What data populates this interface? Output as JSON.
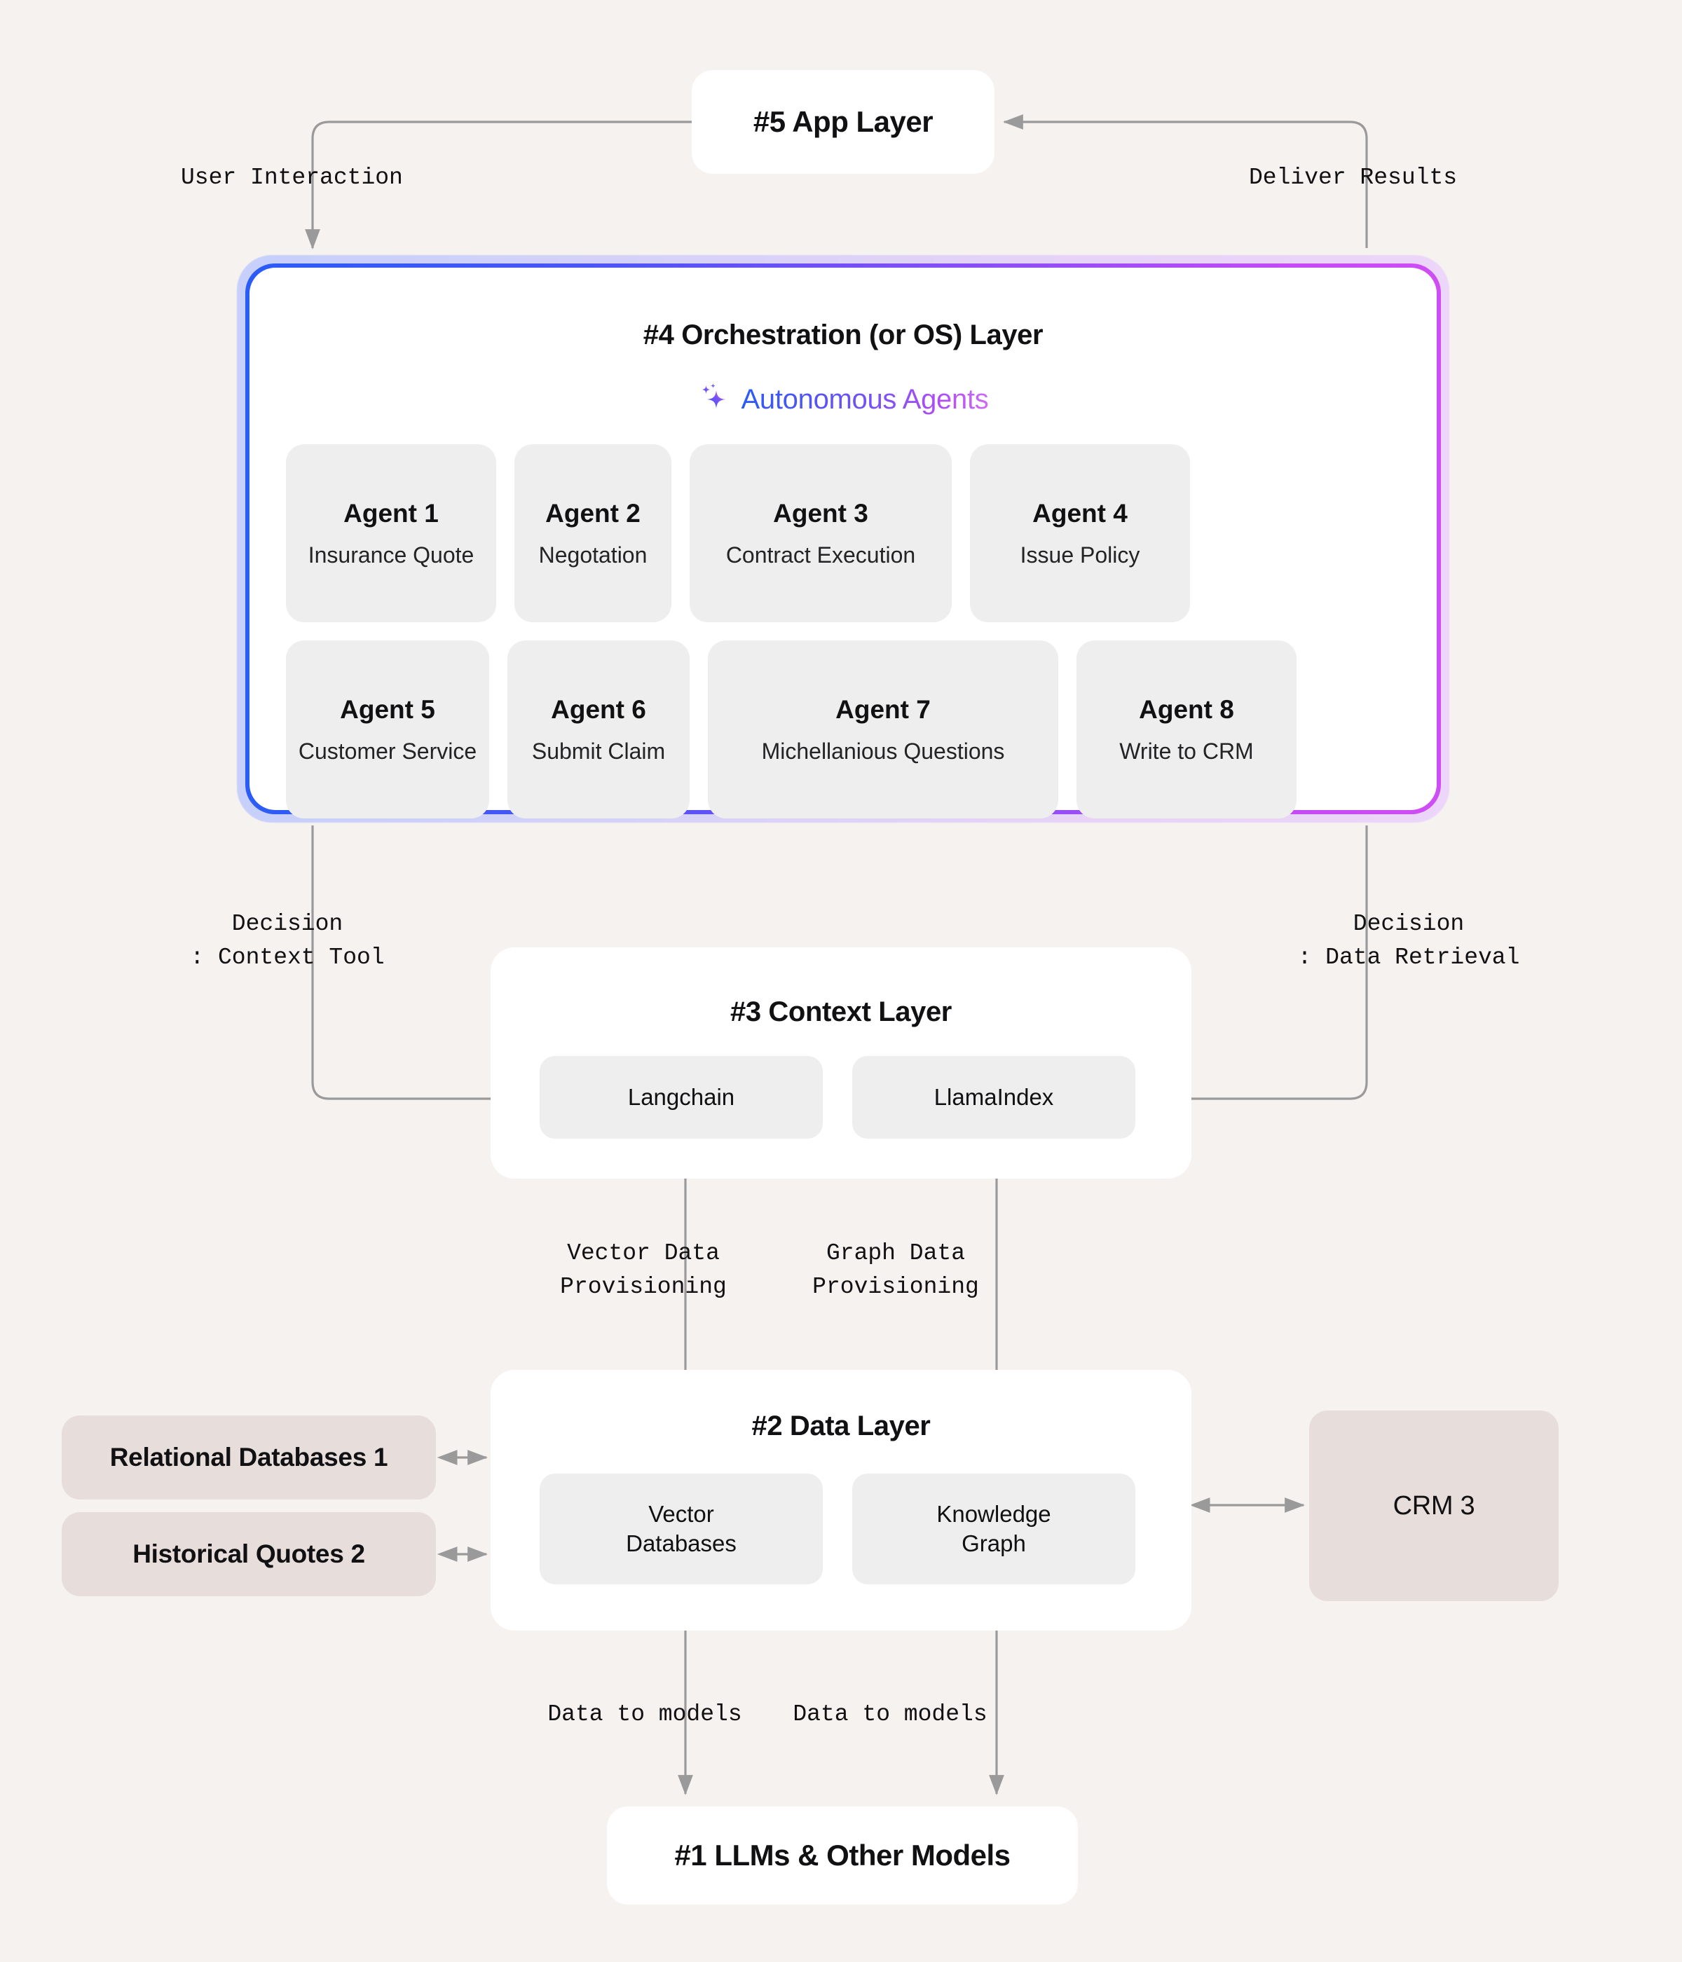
{
  "app_layer": {
    "title": "#5 App Layer"
  },
  "orchestration": {
    "title": "#4 Orchestration (or OS) Layer",
    "badge_label": "Autonomous Agents",
    "badge_icon": "sparkle-icon",
    "agents": [
      {
        "name": "Agent 1",
        "role": "Insurance Quote"
      },
      {
        "name": "Agent 2",
        "role": "Negotation"
      },
      {
        "name": "Agent 3",
        "role": "Contract Execution"
      },
      {
        "name": "Agent 4",
        "role": "Issue Policy"
      },
      {
        "name": "Agent 5",
        "role": "Customer Service"
      },
      {
        "name": "Agent 6",
        "role": "Submit Claim"
      },
      {
        "name": "Agent 7",
        "role": "Michellanious Questions"
      },
      {
        "name": "Agent 8",
        "role": "Write to CRM"
      }
    ]
  },
  "context_layer": {
    "title": "#3 Context Layer",
    "items": [
      {
        "label": "Langchain"
      },
      {
        "label": "LlamaIndex"
      }
    ]
  },
  "data_layer": {
    "title": "#2 Data Layer",
    "items": [
      {
        "line1": "Vector",
        "line2": "Databases"
      },
      {
        "line1": "Knowledge",
        "line2": "Graph"
      }
    ]
  },
  "external": {
    "relational_databases": "Relational Databases 1",
    "historical_quotes": "Historical Quotes 2",
    "crm": "CRM 3"
  },
  "model_layer": {
    "title": "#1 LLMs & Other Models"
  },
  "edges": {
    "user_interaction": "User Interaction",
    "deliver_results": "Deliver Results",
    "decision_context_tool": "Decision\n: Context Tool",
    "decision_data_retrieval": "Decision\n: Data Retrieval",
    "vector_data_provisioning": "Vector Data\nProvisioning",
    "graph_data_provisioning": "Graph Data\nProvisioning",
    "data_to_models_left": "Data to models",
    "data_to_models_right": "Data to models"
  },
  "colors": {
    "background": "#f6f2ef",
    "card": "#ffffff",
    "pill": "#eeeeee",
    "beige": "#e7dedb",
    "gradient_start": "#2b5cf6",
    "gradient_end": "#c44bf5",
    "connector": "#9a9a9a"
  }
}
